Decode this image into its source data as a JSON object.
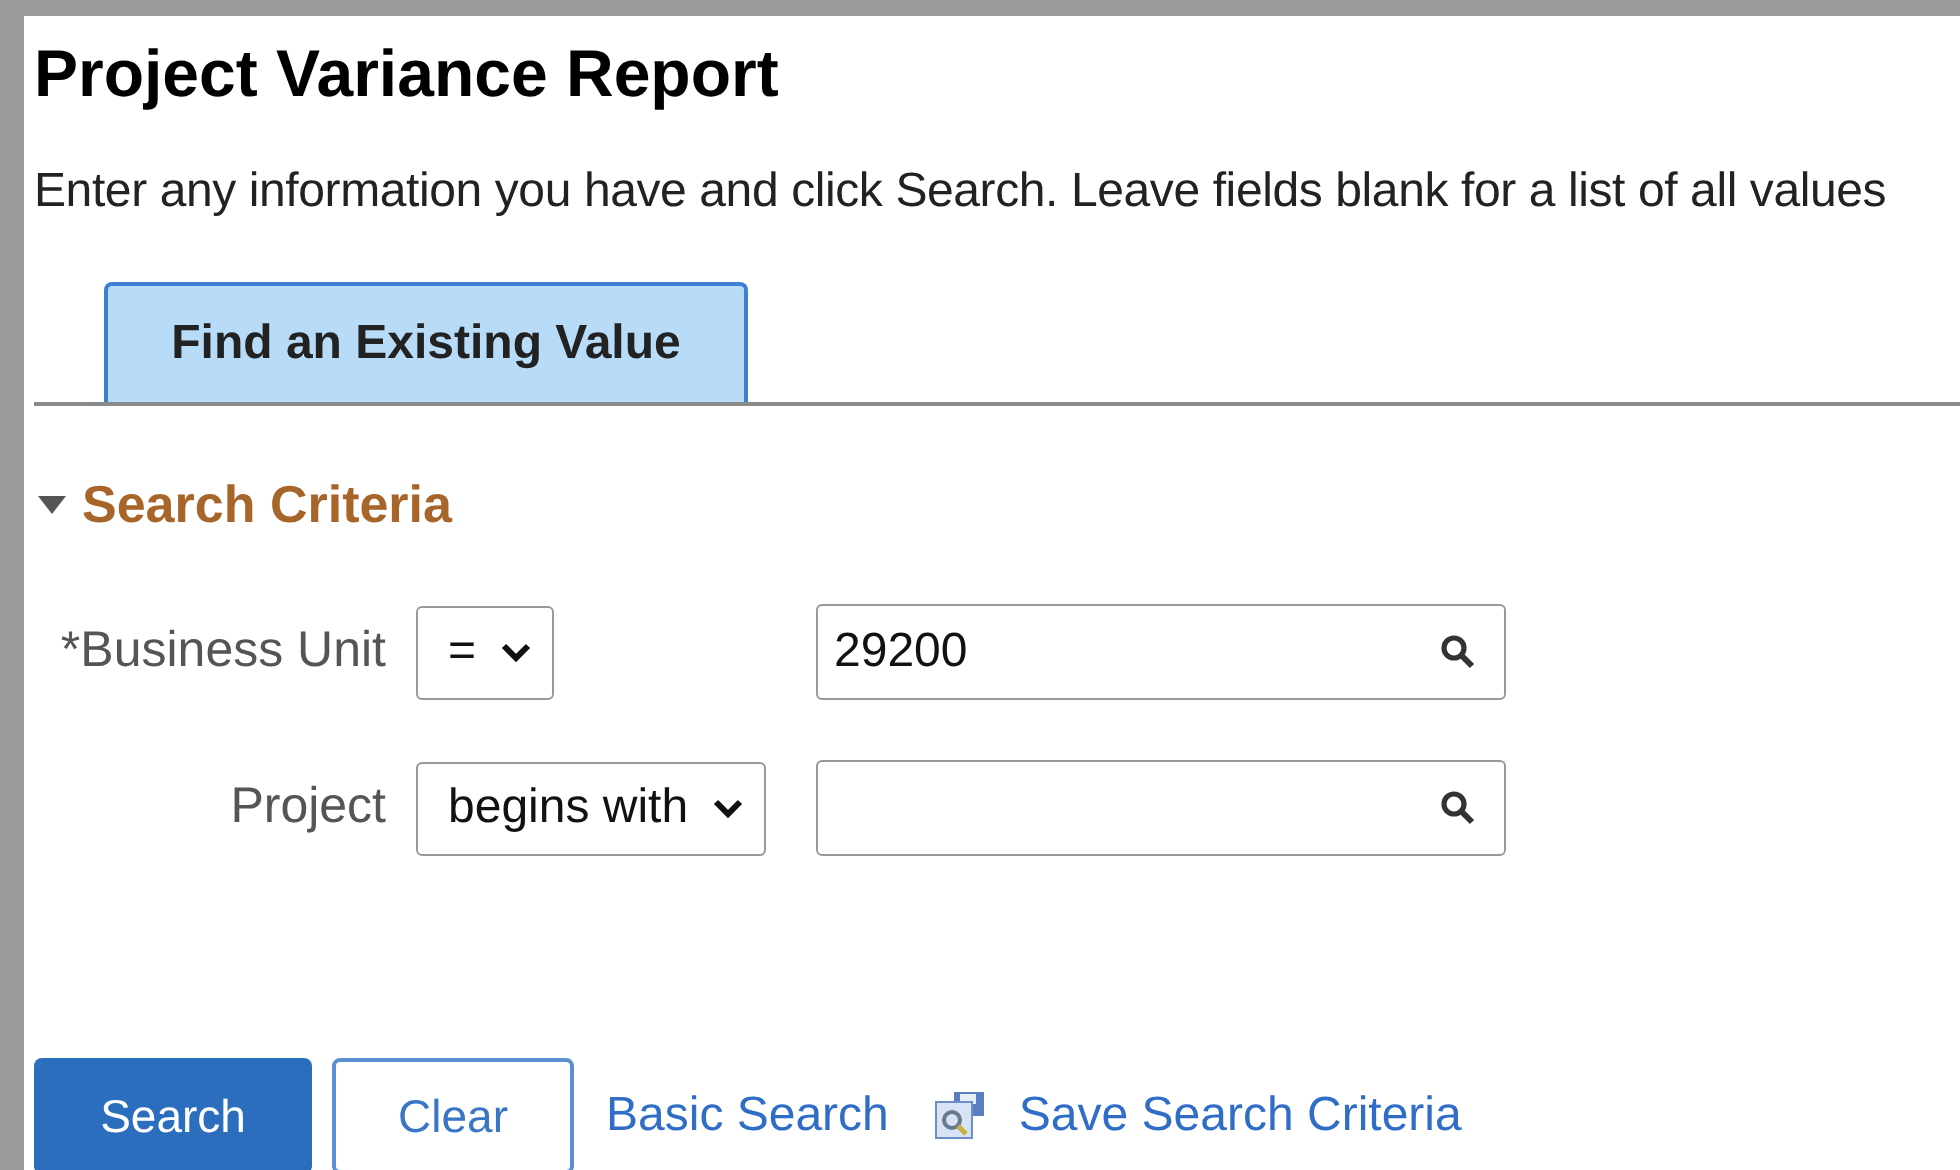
{
  "page": {
    "title": "Project Variance Report",
    "instructions": "Enter any information you have and click Search. Leave fields blank for a list of all values"
  },
  "tabs": [
    {
      "label": "Find an Existing Value",
      "selected": true
    }
  ],
  "section": {
    "title": "Search Criteria",
    "expanded": true
  },
  "fields": [
    {
      "label": "*Business Unit",
      "operator": "=",
      "value": "29200"
    },
    {
      "label": "Project",
      "operator": "begins with"
    }
  ],
  "buttons": [
    {
      "label": "Search",
      "kind": "primary"
    },
    {
      "label": "Clear",
      "kind": "secondary"
    }
  ],
  "links": [
    {
      "label": "Basic Search",
      "kind": "plain"
    },
    {
      "label": "Save Search Criteria",
      "kind": "save"
    }
  ]
}
